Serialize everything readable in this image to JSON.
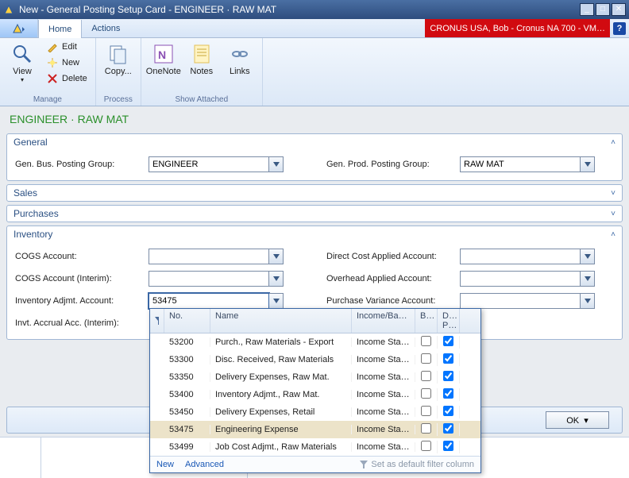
{
  "title": "New - General Posting Setup Card - ENGINEER · RAW MAT",
  "env_info": "CRONUS USA, Bob - Cronus NA 700 - VM…",
  "tabs": {
    "home": "Home",
    "actions": "Actions"
  },
  "ribbon": {
    "manage": {
      "label": "Manage",
      "view": "View",
      "edit": "Edit",
      "new": "New",
      "delete": "Delete"
    },
    "process": {
      "label": "Process",
      "copy": "Copy..."
    },
    "show_attached": {
      "label": "Show Attached",
      "onenote": "OneNote",
      "notes": "Notes",
      "links": "Links"
    }
  },
  "page_title": "ENGINEER · RAW MAT",
  "fasttabs": {
    "general": "General",
    "sales": "Sales",
    "purchases": "Purchases",
    "inventory": "Inventory"
  },
  "general": {
    "gen_bus_label": "Gen. Bus. Posting Group:",
    "gen_bus_value": "ENGINEER",
    "gen_prod_label": "Gen. Prod. Posting Group:",
    "gen_prod_value": "RAW MAT"
  },
  "inventory": {
    "cogs_label": "COGS Account:",
    "cogs_value": "",
    "cogs_interim_label": "COGS Account (Interim):",
    "cogs_interim_value": "",
    "inv_adjmt_label": "Inventory Adjmt. Account:",
    "inv_adjmt_value": "53475",
    "invt_accrual_label": "Invt. Accrual Acc. (Interim):",
    "invt_accrual_value": "",
    "direct_cost_label": "Direct Cost Applied Account:",
    "direct_cost_value": "",
    "overhead_label": "Overhead Applied Account:",
    "overhead_value": "",
    "purch_var_label": "Purchase Variance Account:",
    "purch_var_value": ""
  },
  "lookup": {
    "col_no": "No.",
    "col_name": "Name",
    "col_income": "Income/Ba…",
    "col_b": "B…",
    "col_dp": "D… P…",
    "footer_new": "New",
    "footer_advanced": "Advanced",
    "footer_right": "Set as default filter column",
    "rows": [
      {
        "no": "53200",
        "name": "Purch., Raw Materials - Export",
        "income": "Income Sta…",
        "b": false,
        "dp": true
      },
      {
        "no": "53300",
        "name": "Disc. Received, Raw Materials",
        "income": "Income Sta…",
        "b": false,
        "dp": true
      },
      {
        "no": "53350",
        "name": "Delivery Expenses, Raw Mat.",
        "income": "Income Sta…",
        "b": false,
        "dp": true
      },
      {
        "no": "53400",
        "name": "Inventory Adjmt., Raw Mat.",
        "income": "Income Sta…",
        "b": false,
        "dp": true
      },
      {
        "no": "53450",
        "name": "Delivery Expenses, Retail",
        "income": "Income Sta…",
        "b": false,
        "dp": true
      },
      {
        "no": "53475",
        "name": "Engineering Expense",
        "income": "Income Sta…",
        "b": false,
        "dp": true
      },
      {
        "no": "53499",
        "name": "Job Cost Adjmt., Raw Materials",
        "income": "Income Sta…",
        "b": false,
        "dp": true
      }
    ],
    "selected_no": "53475"
  },
  "ok_label": "OK"
}
